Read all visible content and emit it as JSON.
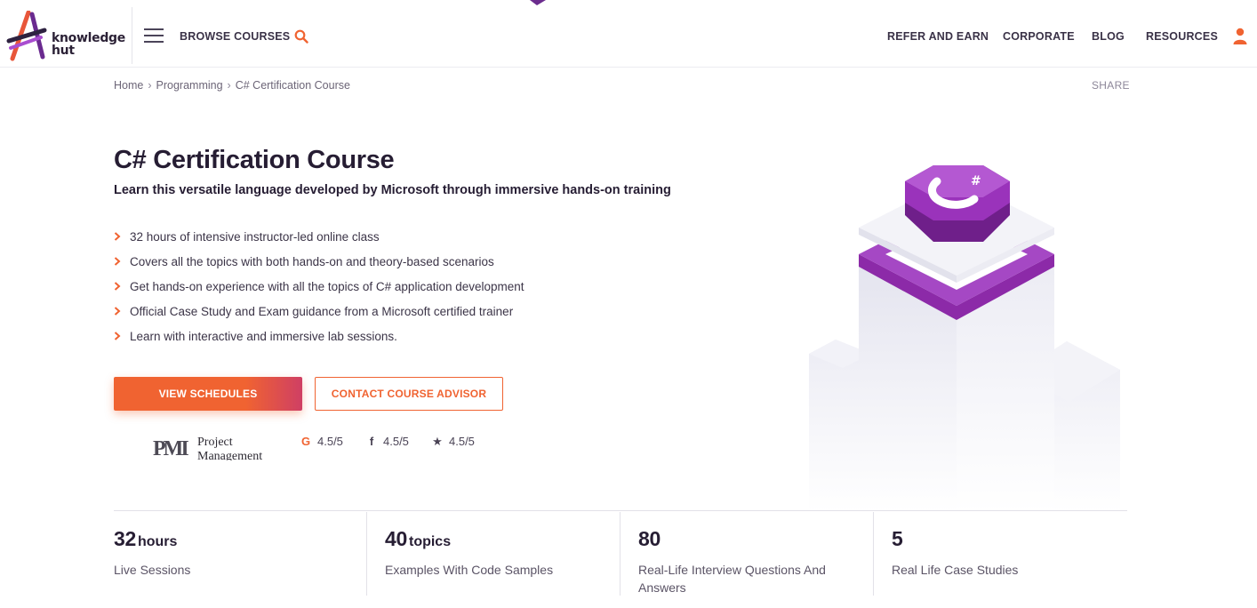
{
  "header": {
    "logo_text_line1": "knowledge",
    "logo_text_line2": "hut",
    "browse_label": "BROWSE COURSES",
    "search_icon": "search-icon",
    "nav": [
      "REFER AND EARN",
      "CORPORATE",
      "BLOG",
      "RESOURCES"
    ],
    "user_icon": "user-icon"
  },
  "breadcrumb": {
    "items": [
      "Home",
      "Programming",
      "C# Certification Course"
    ],
    "share_label": "SHARE"
  },
  "hero": {
    "title": "C# Certification Course",
    "subtitle": "Learn this versatile language developed by Microsoft through immersive hands-on training",
    "features": [
      "32 hours of intensive instructor-led online class",
      "Covers all the topics with both hands-on and theory-based scenarios",
      "Get hands-on experience with all the topics of C# application development",
      "Official Case Study and Exam guidance from a Microsoft certified trainer",
      "Learn with interactive and immersive lab sessions."
    ],
    "primary_button": "VIEW SCHEDULES",
    "secondary_button": "CONTACT COURSE ADVISOR",
    "pmi_mark": "PMI",
    "pmi_text_line1": "Project",
    "pmi_text_line2": "Management",
    "ratings": [
      {
        "icon": "google-icon",
        "glyph": "G",
        "value": "4.5/5"
      },
      {
        "icon": "facebook-icon",
        "glyph": "f",
        "value": "4.5/5"
      },
      {
        "icon": "star-icon",
        "glyph": "★",
        "value": "4.5/5"
      }
    ]
  },
  "stats": [
    {
      "number": "32",
      "unit": "hours",
      "label": "Live Sessions"
    },
    {
      "number": "40",
      "unit": "topics",
      "label": "Examples With Code Samples"
    },
    {
      "number": "80",
      "unit": "",
      "label": "Real-Life Interview Questions And Answers"
    },
    {
      "number": "5",
      "unit": "",
      "label": "Real Life Case Studies"
    }
  ],
  "colors": {
    "accent": "#f06331",
    "purple": "#8a2aa6",
    "text_dark": "#261d33"
  }
}
